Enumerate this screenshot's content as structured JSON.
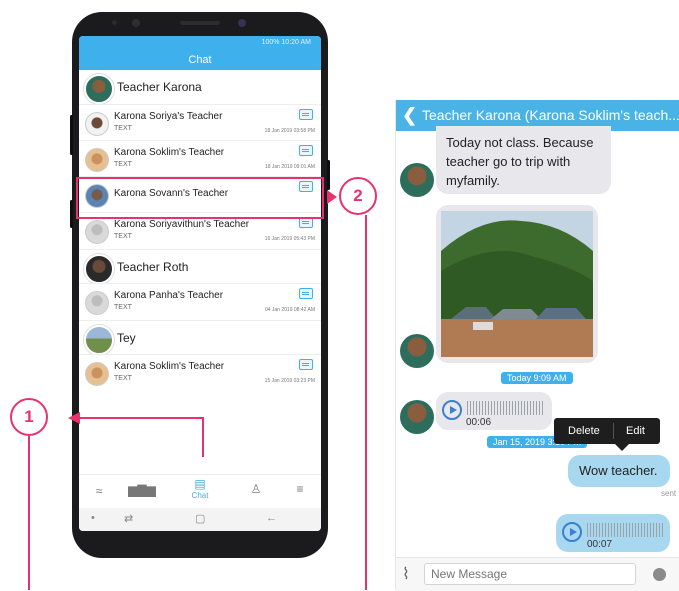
{
  "status_text": "100% 10:20 AM",
  "app_title": "Chat",
  "groups": [
    {
      "name": "Teacher Karona",
      "items": [
        {
          "name": "Karona Soriya's Teacher",
          "type": "TEXT",
          "date": "18 Jan 2019 03:58 PM"
        },
        {
          "name": "Karona Soklim's Teacher",
          "type": "TEXT",
          "date": "18 Jan 2019 09:01 AM"
        },
        {
          "name": "Karona Sovann's Teacher",
          "type": "",
          "date": ""
        },
        {
          "name": "Karona Soriyavithun's Teacher",
          "type": "TEXT",
          "date": "16 Jan 2019 05:43 PM"
        }
      ]
    },
    {
      "name": "Teacher Roth",
      "items": [
        {
          "name": "Karona Panha's Teacher",
          "type": "TEXT",
          "date": "04 Jan 2019 08:42 AM"
        }
      ]
    },
    {
      "name": "Tey",
      "items": [
        {
          "name": "Karona Soklim's Teacher",
          "type": "TEXT",
          "date": "15 Jan 2019 03:23 PM"
        }
      ]
    }
  ],
  "tabs": {
    "chat_label": "Chat"
  },
  "callouts": {
    "one": "1",
    "two": "2"
  },
  "conversation": {
    "title": "Teacher Karona (Karona Soklim's teach...",
    "message_text": "Today not class. Because teacher go to trip with myfamily.",
    "stamp_today": "Today 9:09 AM",
    "audio_in_duration": "00:06",
    "stamp_jan": "Jan 15, 2019 3:10 PM",
    "menu_delete": "Delete",
    "menu_edit": "Edit",
    "outgoing_text": "Wow teacher.",
    "sent_label": "sent",
    "audio_out_duration": "00:07",
    "input_placeholder": "New Message"
  },
  "colors": {
    "accent": "#3eb0ec",
    "callout": "#e8326e",
    "header": "#49b3e5"
  }
}
